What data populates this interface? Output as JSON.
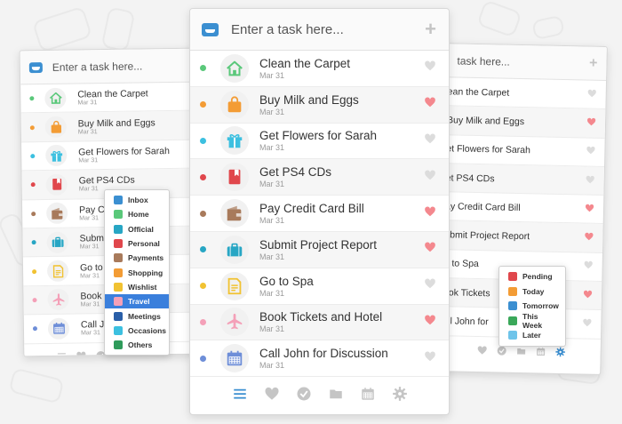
{
  "header": {
    "placeholder": "Enter a task here...",
    "add_symbol": "+"
  },
  "tasks": [
    {
      "title": "Clean the Carpet",
      "date": "Mar 31",
      "dot": "#5ac87a",
      "icon": "home-icon",
      "favorite": false
    },
    {
      "title": "Buy Milk and Eggs",
      "date": "Mar 31",
      "dot": "#f39c35",
      "icon": "shopping-bag-icon",
      "favorite": true
    },
    {
      "title": "Get Flowers for Sarah",
      "date": "Mar 31",
      "dot": "#3cc0e0",
      "icon": "gift-icon",
      "favorite": false
    },
    {
      "title": "Get PS4 CDs",
      "date": "Mar 31",
      "dot": "#e0474c",
      "icon": "book-icon",
      "favorite": false
    },
    {
      "title": "Pay Credit Card Bill",
      "date": "Mar 31",
      "dot": "#a87a5b",
      "icon": "wallet-icon",
      "favorite": true
    },
    {
      "title": "Submit Project Report",
      "date": "Mar 31",
      "dot": "#27a6c4",
      "icon": "briefcase-icon",
      "favorite": true
    },
    {
      "title": "Go to Spa",
      "date": "Mar 31",
      "dot": "#f1c232",
      "icon": "note-icon",
      "favorite": false
    },
    {
      "title": "Book Tickets and Hotel",
      "date": "Mar 31",
      "dot": "#f4a0b8",
      "icon": "airplane-icon",
      "favorite": true
    },
    {
      "title": "Call John for Discussion",
      "date": "Mar 31",
      "dot": "#6e8ed8",
      "icon": "calendar-icon",
      "favorite": false
    }
  ],
  "left_panel": {
    "tasks": [
      {
        "title": "Clean the Carpet",
        "date": "Mar 31"
      },
      {
        "title": "Buy Milk and Eggs",
        "date": "Mar 31"
      },
      {
        "title": "Get Flowers for Sarah",
        "date": "Mar 31"
      },
      {
        "title": "Get PS4 CDs",
        "date": "Mar 31"
      },
      {
        "title": "Pay Cre",
        "date": "Mar 31"
      },
      {
        "title": "Submit I",
        "date": "Mar 31"
      },
      {
        "title": "Go to S",
        "date": "Mar 31"
      },
      {
        "title": "Book Ti",
        "date": "Mar 31"
      },
      {
        "title": "Call Joh",
        "date": "Mar 31"
      }
    ]
  },
  "right_panel": {
    "placeholder": "task here...",
    "tasks": [
      {
        "title": "ean the Carpet",
        "date": "",
        "favorite": false
      },
      {
        "title": "Buy Milk and Eggs",
        "date": "",
        "favorite": true
      },
      {
        "title": "et Flowers for Sarah",
        "date": "",
        "favorite": false
      },
      {
        "title": "et PS4 CDs",
        "date": "",
        "favorite": false
      },
      {
        "title": "ay Credit Card Bill",
        "date": "",
        "favorite": true
      },
      {
        "title": "ubmit Project Report",
        "date": "",
        "favorite": true
      },
      {
        "title": "o to Spa",
        "date": "",
        "favorite": false
      },
      {
        "title": "ook Tickets",
        "date": "",
        "favorite": true
      },
      {
        "title": "all John for",
        "date": "",
        "favorite": false
      }
    ]
  },
  "folder_menu": {
    "items": [
      {
        "label": "Inbox",
        "color": "#3b8fd1"
      },
      {
        "label": "Home",
        "color": "#5ac87a"
      },
      {
        "label": "Official",
        "color": "#27a6c4"
      },
      {
        "label": "Personal",
        "color": "#e0474c"
      },
      {
        "label": "Payments",
        "color": "#a87a5b"
      },
      {
        "label": "Shopping",
        "color": "#f39c35"
      },
      {
        "label": "Wishlist",
        "color": "#f1c232"
      },
      {
        "label": "Travel",
        "color": "#f4a0b8"
      },
      {
        "label": "Meetings",
        "color": "#2a5fa8"
      },
      {
        "label": "Occasions",
        "color": "#3cc0e0"
      },
      {
        "label": "Others",
        "color": "#2f9b5b"
      }
    ],
    "selected": "Travel"
  },
  "date_menu": {
    "items": [
      {
        "label": "Pending",
        "color": "#e0474c"
      },
      {
        "label": "Today",
        "color": "#f39c35"
      },
      {
        "label": "Tomorrow",
        "color": "#3b8fd1"
      },
      {
        "label": "This Week",
        "color": "#3aa85a"
      },
      {
        "label": "Later",
        "color": "#6ec4ea"
      }
    ]
  },
  "footer": {
    "icons": [
      "list-icon",
      "heart-icon",
      "check-icon",
      "folder-icon",
      "calendar-icon",
      "gear-icon"
    ],
    "active_color": "#3b8fd1",
    "icon_color": "#c5c5c5"
  },
  "colors": {
    "heart_on": "#f4888e",
    "heart_off": "#dcdcdc"
  }
}
